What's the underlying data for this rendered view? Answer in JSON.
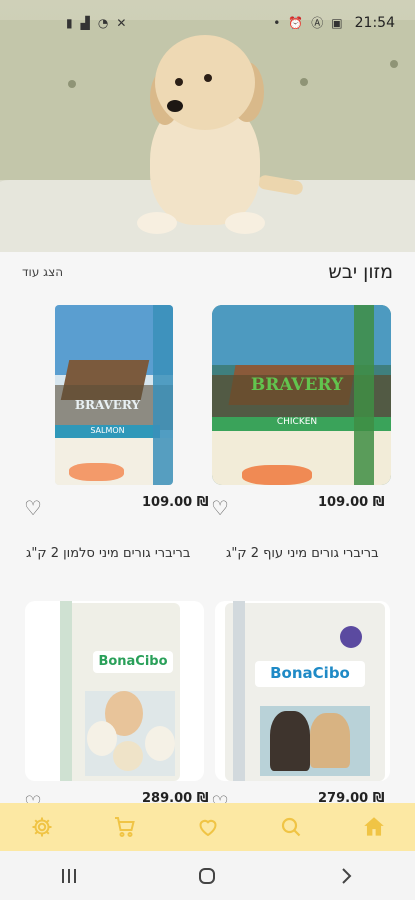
{
  "status_bar": {
    "time": "21:54",
    "icons_left": [
      "battery-icon",
      "signal-icon",
      "wifi-icon",
      "mute-icon"
    ],
    "icons_right": [
      "dot-icon",
      "alarm-icon",
      "accessibility-icon",
      "image-icon"
    ]
  },
  "section": {
    "title": "מזון יבש",
    "show_more": "הצג עוד"
  },
  "products": [
    {
      "name": "בריברי גורים מיני עוף 2 ק\"ג",
      "price": "109.00 ₪",
      "brand": "BRAVERY",
      "variant": "CHICKEN"
    },
    {
      "name": "בריברי גורים מיני סלמון 2 ק\"ג",
      "price": "109.00 ₪",
      "brand": "BRAVERY",
      "variant": "SALMON"
    },
    {
      "name": "",
      "price": "279.00 ₪",
      "brand": "BonaCibo",
      "variant": ""
    },
    {
      "name": "",
      "price": "289.00 ₪",
      "brand": "BonaCibo",
      "variant": ""
    }
  ],
  "bottom_nav": [
    "home-icon",
    "search-icon",
    "heart-icon",
    "cart-icon",
    "settings-icon"
  ],
  "colors": {
    "accent": "#fce8a3",
    "nav_icon": "#f0c445",
    "nav_icon_active": "#e2a820"
  }
}
